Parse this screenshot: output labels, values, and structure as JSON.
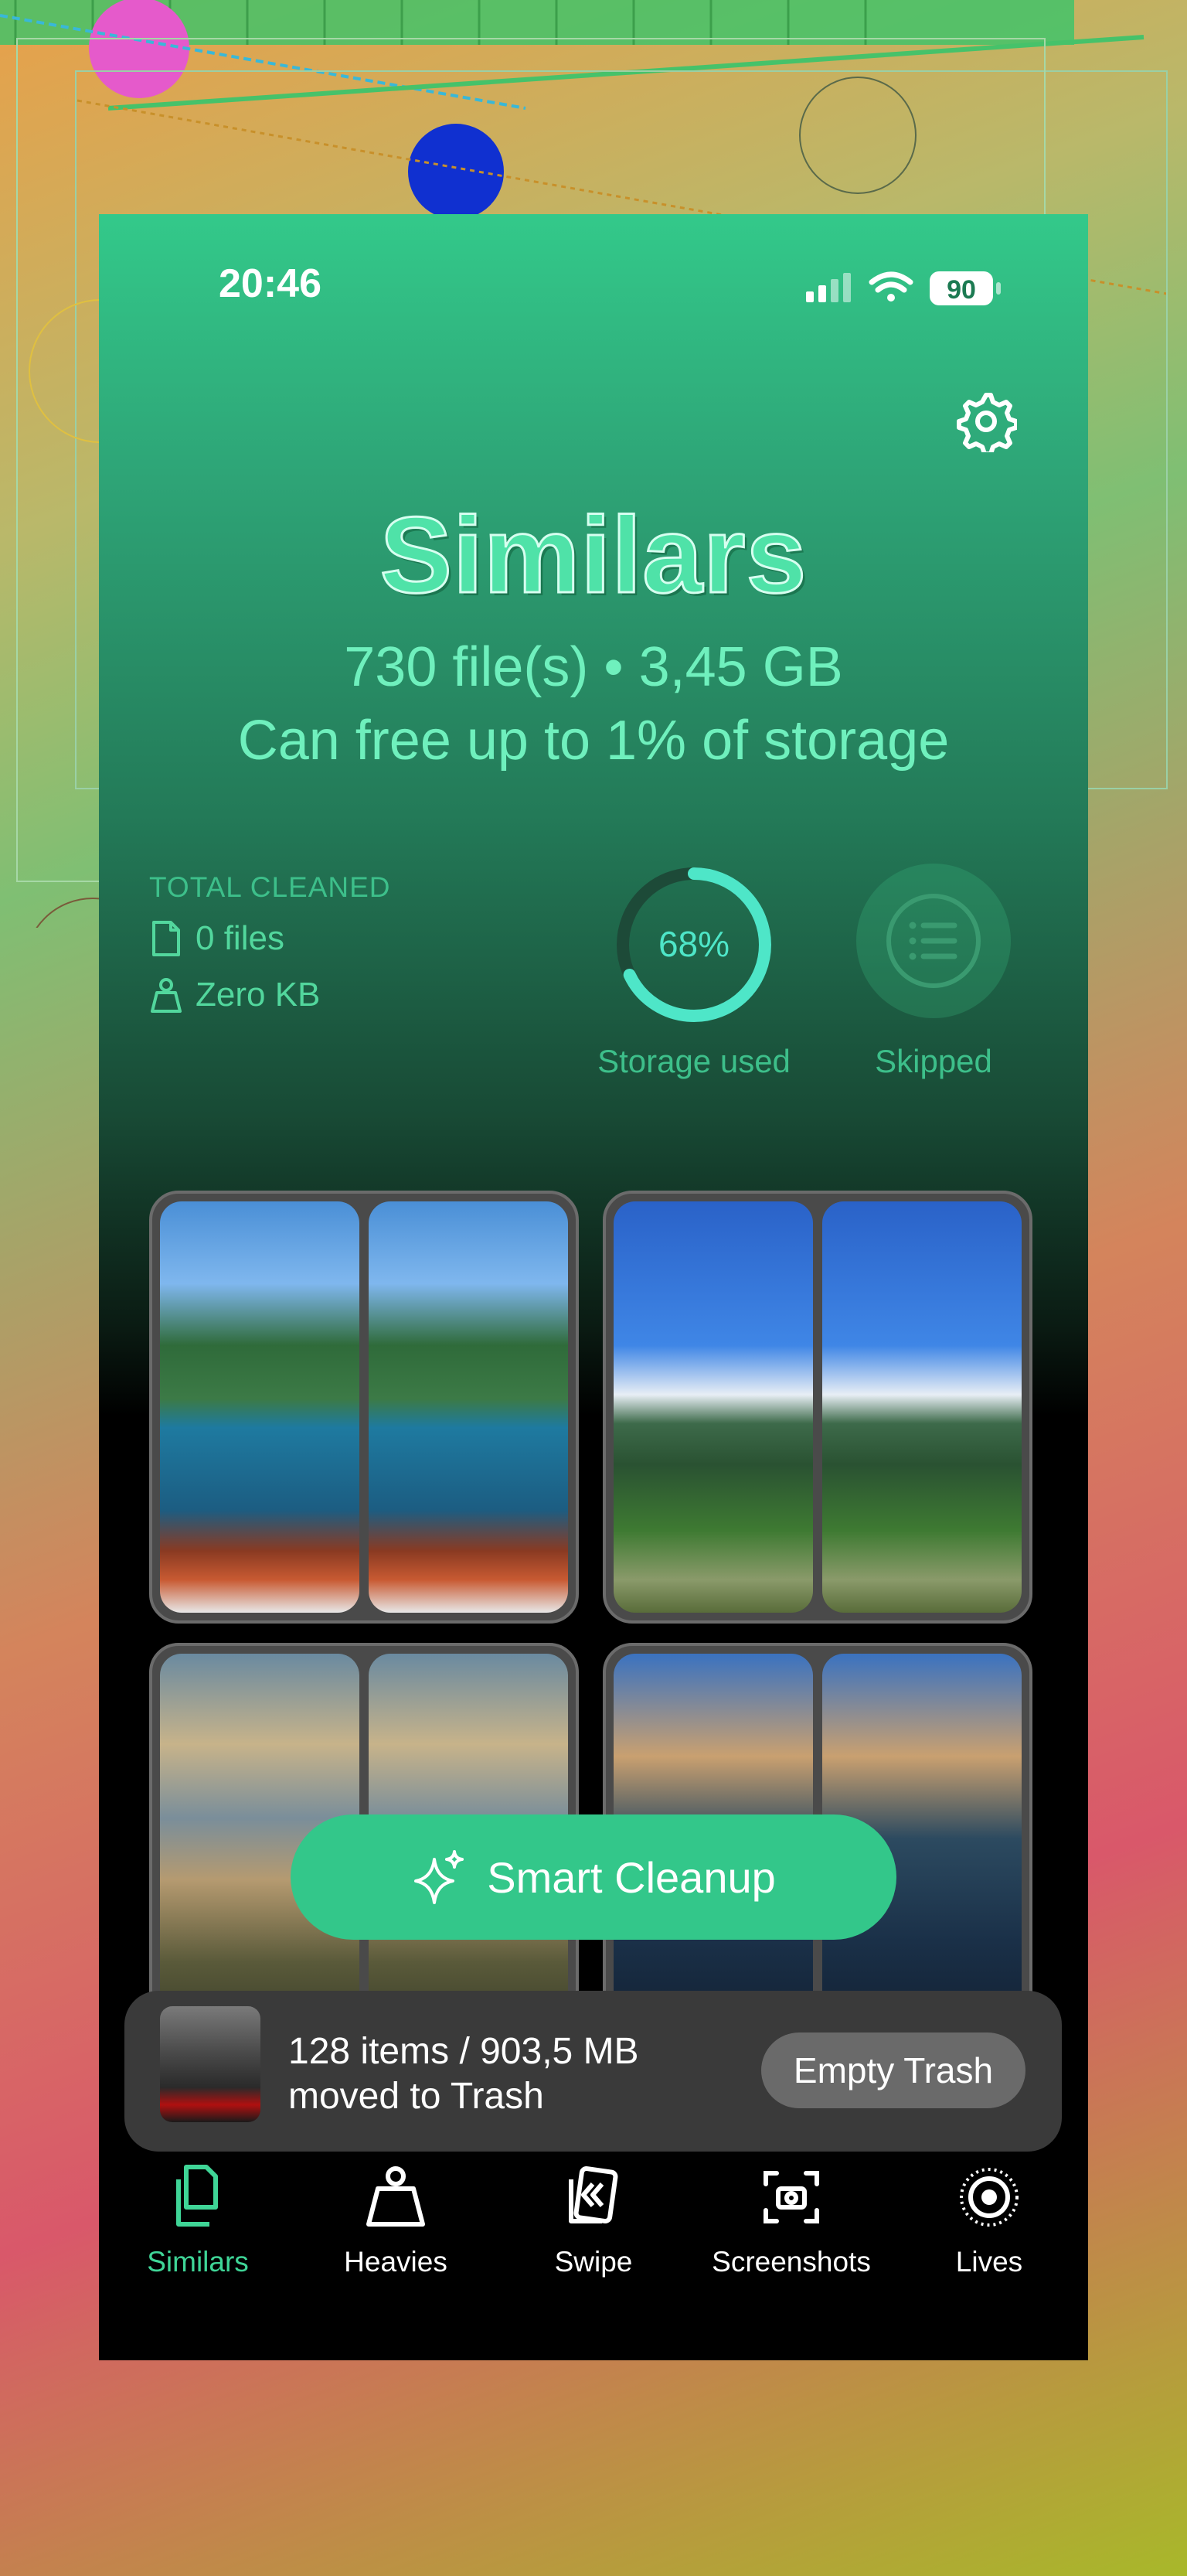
{
  "status": {
    "time": "20:46",
    "battery": "90"
  },
  "header": {
    "title": "Similars",
    "files_summary": "730 file(s) • 3,45 GB",
    "free_up": "Can free up to 1% of storage"
  },
  "stats": {
    "total_cleaned_label": "TOTAL CLEANED",
    "files_value": "0 files",
    "size_value": "Zero KB",
    "storage_percent_text": "68%",
    "storage_percent": 0.68,
    "storage_label": "Storage used",
    "skipped_label": "Skipped"
  },
  "actions": {
    "smart_cleanup": "Smart Cleanup"
  },
  "trash": {
    "line1": "128 items / 903,5 MB",
    "line2": "moved to Trash",
    "empty_button": "Empty Trash"
  },
  "tabs": [
    {
      "label": "Similars",
      "icon": "similars-icon",
      "active": true
    },
    {
      "label": "Heavies",
      "icon": "weight-icon"
    },
    {
      "label": "Swipe",
      "icon": "swipe-icon"
    },
    {
      "label": "Screenshots",
      "icon": "screenshot-icon"
    },
    {
      "label": "Lives",
      "icon": "live-photo-icon"
    }
  ],
  "colors": {
    "accent": "#33c78a",
    "accent_text": "#3fd597"
  }
}
